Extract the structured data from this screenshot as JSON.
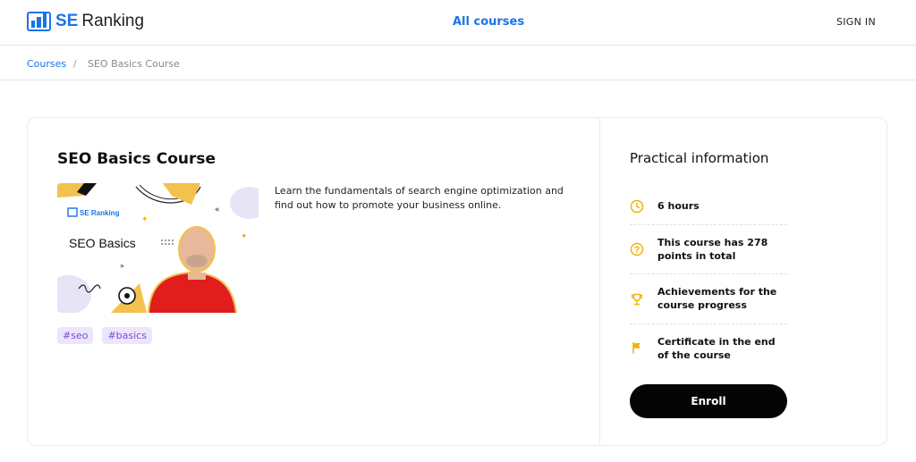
{
  "brand": {
    "se": "SE",
    "ranking": "Ranking",
    "color": "#1a73e8"
  },
  "nav": {
    "all_courses": "All courses",
    "sign_in": "SIGN IN"
  },
  "breadcrumb": {
    "root": "Courses",
    "separator": "/",
    "current": "SEO Basics Course"
  },
  "course": {
    "title": "SEO Basics Course",
    "description": "Learn the fundamentals of search engine optimization and find out how to promote your business online.",
    "thumbnail": {
      "brand_text": "SE Ranking",
      "title": "SEO Basics"
    },
    "tags": [
      "#seo",
      "#basics"
    ]
  },
  "practical": {
    "title": "Practical information",
    "items": [
      {
        "icon": "clock-icon",
        "text": "6 hours"
      },
      {
        "icon": "question-circle-icon",
        "text": "This course has 278 points in total"
      },
      {
        "icon": "trophy-icon",
        "text": "Achievements for the course progress"
      },
      {
        "icon": "flag-icon",
        "text": "Certificate in the end of the course"
      }
    ],
    "icon_color": "#f0b400",
    "enroll_label": "Enroll"
  }
}
